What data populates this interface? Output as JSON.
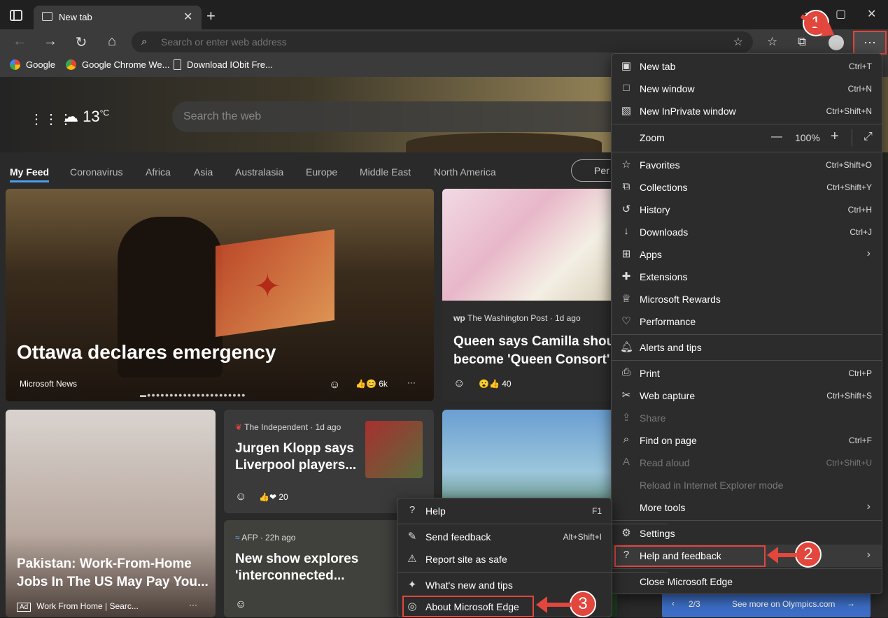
{
  "tab": {
    "title": "New tab",
    "close": "✕"
  },
  "window": {
    "minimize": "—",
    "maximize": "▢",
    "close": "✕"
  },
  "address": {
    "placeholder": "Search or enter web address"
  },
  "bookmarks": [
    "Google",
    "Google Chrome We...",
    "Download IObit Fre..."
  ],
  "weather": {
    "temp": "13",
    "unit": "°C"
  },
  "hero_search": {
    "placeholder": "Search the web"
  },
  "feed_nav": [
    "My Feed",
    "Coronavirus",
    "Africa",
    "Asia",
    "Australasia",
    "Europe",
    "Middle East",
    "North America"
  ],
  "personalize": "Per",
  "cards": {
    "c1": {
      "title": "Ottawa declares emergency",
      "source": "Microsoft News",
      "reactions": "6k"
    },
    "c2": {
      "source": "The Washington Post · 1d ago",
      "title": "Queen says Camilla shou become 'Queen Consort'",
      "reactions": "40"
    },
    "c3": {
      "title": "Pakistan: Work-From-Home Jobs In The US May Pay You...",
      "ad": "Ad",
      "source": "Work From Home | Searc..."
    },
    "c4": {
      "source": "The Independent · 1d ago",
      "title": "Jurgen Klopp says Liverpool players...",
      "reactions": "20"
    },
    "c5": {
      "source": "AFP · 22h ago",
      "title": "New show explores 'interconnected..."
    },
    "olympics": {
      "page": "2/3",
      "link": "See more on Olympics.com"
    }
  },
  "menu": {
    "items": [
      {
        "label": "New tab",
        "shortcut": "Ctrl+T"
      },
      {
        "label": "New window",
        "shortcut": "Ctrl+N"
      },
      {
        "label": "New InPrivate window",
        "shortcut": "Ctrl+Shift+N"
      },
      {
        "label": "Zoom",
        "value": "100%"
      },
      {
        "label": "Favorites",
        "shortcut": "Ctrl+Shift+O"
      },
      {
        "label": "Collections",
        "shortcut": "Ctrl+Shift+Y"
      },
      {
        "label": "History",
        "shortcut": "Ctrl+H"
      },
      {
        "label": "Downloads",
        "shortcut": "Ctrl+J"
      },
      {
        "label": "Apps",
        "shortcut": ""
      },
      {
        "label": "Extensions",
        "shortcut": ""
      },
      {
        "label": "Microsoft Rewards",
        "shortcut": ""
      },
      {
        "label": "Performance",
        "shortcut": ""
      },
      {
        "label": "Alerts and tips",
        "shortcut": ""
      },
      {
        "label": "Print",
        "shortcut": "Ctrl+P"
      },
      {
        "label": "Web capture",
        "shortcut": "Ctrl+Shift+S"
      },
      {
        "label": "Share",
        "shortcut": ""
      },
      {
        "label": "Find on page",
        "shortcut": "Ctrl+F"
      },
      {
        "label": "Read aloud",
        "shortcut": "Ctrl+Shift+U"
      },
      {
        "label": "Reload in Internet Explorer mode",
        "shortcut": ""
      },
      {
        "label": "More tools",
        "shortcut": ""
      },
      {
        "label": "Settings",
        "shortcut": ""
      },
      {
        "label": "Help and feedback",
        "shortcut": ""
      },
      {
        "label": "Close Microsoft Edge",
        "shortcut": ""
      }
    ]
  },
  "submenu": {
    "items": [
      {
        "label": "Help",
        "shortcut": "F1"
      },
      {
        "label": "Send feedback",
        "shortcut": "Alt+Shift+I"
      },
      {
        "label": "Report site as safe",
        "shortcut": ""
      },
      {
        "label": "What's new and tips",
        "shortcut": ""
      },
      {
        "label": "About Microsoft Edge",
        "shortcut": ""
      }
    ]
  },
  "annotations": {
    "step1": "1",
    "step2": "2",
    "step3": "3"
  },
  "colors": {
    "highlight": "#e2463c",
    "accent": "#4aa0e6"
  }
}
